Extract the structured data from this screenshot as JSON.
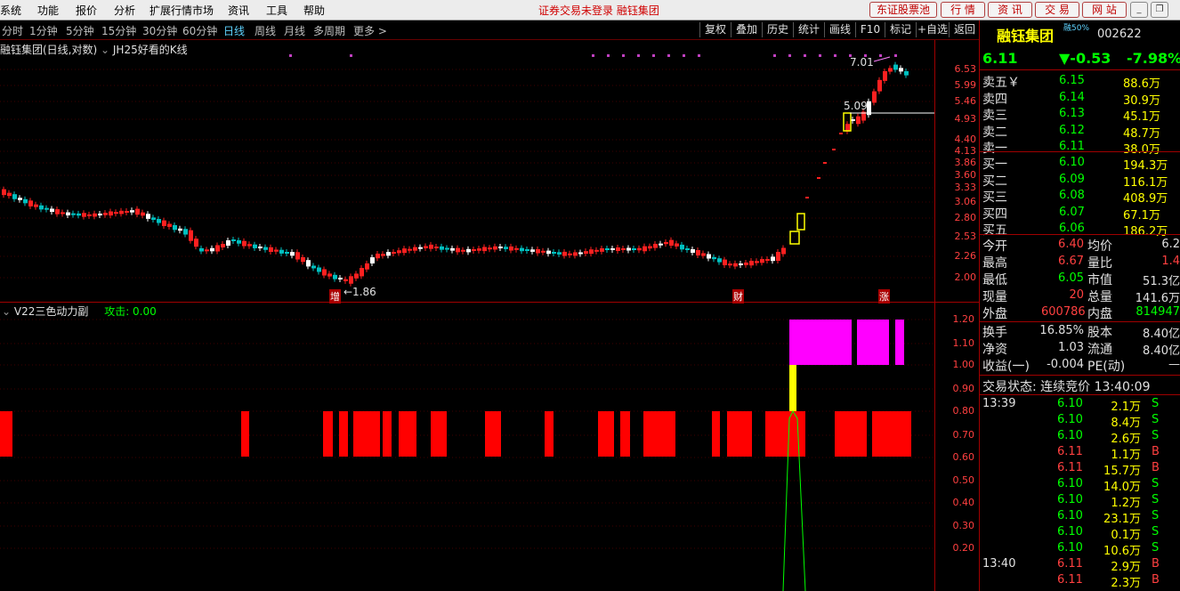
{
  "menu": {
    "items": [
      "系统",
      "功能",
      "报价",
      "分析",
      "扩展行情市场",
      "资讯",
      "工具",
      "帮助"
    ],
    "notice": "证券交易未登录 融钰集团",
    "buttons": [
      "东证股票池",
      "行 情",
      "资 讯",
      "交 易",
      "网 站"
    ]
  },
  "periods": {
    "items": [
      "分时",
      "1分钟",
      "5分钟",
      "15分钟",
      "30分钟",
      "60分钟",
      "日线",
      "周线",
      "月线",
      "多周期",
      "更多 >"
    ],
    "active": "日线"
  },
  "toolbar": [
    "复权",
    "叠加",
    "历史",
    "统计",
    "画线",
    "F10",
    "标记",
    "+自选",
    "返回"
  ],
  "main_panel": {
    "title": "融钰集团(日线,对数)",
    "indicator": "JH25好看的K线",
    "markers": {
      "low": "←1.86",
      "high": "7.01",
      "mid": "5.09",
      "tag_zeng": "增",
      "tag_cai": "财",
      "tag_zhang": "涨"
    },
    "axis": [
      "6.53",
      "5.99",
      "5.46",
      "4.93",
      "4.40",
      "4.13",
      "3.86",
      "3.60",
      "3.33",
      "3.06",
      "2.80",
      "2.53",
      "2.26",
      "2.00"
    ]
  },
  "sub_panel": {
    "title": "V22三色动力副",
    "label": "攻击: 0.00",
    "axis": [
      "1.20",
      "1.10",
      "1.00",
      "0.90",
      "0.80",
      "0.70",
      "0.60",
      "0.50",
      "0.40",
      "0.30",
      "0.20"
    ]
  },
  "quote": {
    "name": "融钰集团",
    "code": "002622",
    "tag": "融50%",
    "price": "6.11",
    "change": "▼-0.53",
    "pct": "-7.98%",
    "asks": [
      {
        "label": "卖五￥",
        "price": "6.15",
        "vol": "88.6万"
      },
      {
        "label": "卖四",
        "price": "6.14",
        "vol": "30.9万"
      },
      {
        "label": "卖三",
        "price": "6.13",
        "vol": "45.1万"
      },
      {
        "label": "卖二",
        "price": "6.12",
        "vol": "48.7万"
      },
      {
        "label": "卖一",
        "price": "6.11",
        "vol": "38.0万"
      }
    ],
    "bids": [
      {
        "label": "买一",
        "price": "6.10",
        "vol": "194.3万"
      },
      {
        "label": "买二",
        "price": "6.09",
        "vol": "116.1万"
      },
      {
        "label": "买三",
        "price": "6.08",
        "vol": "408.9万"
      },
      {
        "label": "买四",
        "price": "6.07",
        "vol": "67.1万"
      },
      {
        "label": "买五",
        "price": "6.06",
        "vol": "186.2万"
      }
    ],
    "stats": [
      {
        "l1": "今开",
        "v1": "6.40",
        "l2": "均价",
        "v2": "6.2"
      },
      {
        "l1": "最高",
        "v1": "6.67",
        "l2": "量比",
        "v2": "1.4"
      },
      {
        "l1": "最低",
        "v1": "6.05",
        "l2": "市值",
        "v2": "51.3亿"
      },
      {
        "l1": "现量",
        "v1": "20",
        "l2": "总量",
        "v2": "141.6万"
      },
      {
        "l1": "外盘",
        "v1": "600786",
        "l2": "内盘",
        "v2": "814947"
      }
    ],
    "stats2": [
      {
        "l1": "换手",
        "v1": "16.85%",
        "l2": "股本",
        "v2": "8.40亿"
      },
      {
        "l1": "净资",
        "v1": "1.03",
        "l2": "流通",
        "v2": "8.40亿"
      },
      {
        "l1": "收益(一)",
        "v1": "-0.004",
        "l2": "PE(动)",
        "v2": "—"
      }
    ],
    "status": "交易状态: 连续竞价 13:40:09",
    "ticks": [
      {
        "t": "13:39",
        "p": "6.10",
        "v": "2.1万",
        "s": "S"
      },
      {
        "t": "",
        "p": "6.10",
        "v": "8.4万",
        "s": "S"
      },
      {
        "t": "",
        "p": "6.10",
        "v": "2.6万",
        "s": "S"
      },
      {
        "t": "",
        "p": "6.11",
        "v": "1.1万",
        "s": "B"
      },
      {
        "t": "",
        "p": "6.11",
        "v": "15.7万",
        "s": "B"
      },
      {
        "t": "",
        "p": "6.10",
        "v": "14.0万",
        "s": "S"
      },
      {
        "t": "",
        "p": "6.10",
        "v": "1.2万",
        "s": "S"
      },
      {
        "t": "",
        "p": "6.10",
        "v": "23.1万",
        "s": "S"
      },
      {
        "t": "",
        "p": "6.10",
        "v": "0.1万",
        "s": "S"
      },
      {
        "t": "",
        "p": "6.10",
        "v": "10.6万",
        "s": "S"
      },
      {
        "t": "13:40",
        "p": "6.11",
        "v": "2.9万",
        "s": "B"
      },
      {
        "t": "",
        "p": "6.11",
        "v": "2.3万",
        "s": "B"
      }
    ]
  },
  "colors": {
    "up": "#ff2020",
    "down": "#00c0c0",
    "magenta": "#ff00ff",
    "yellow": "#ffff00",
    "green": "#00ff00"
  }
}
